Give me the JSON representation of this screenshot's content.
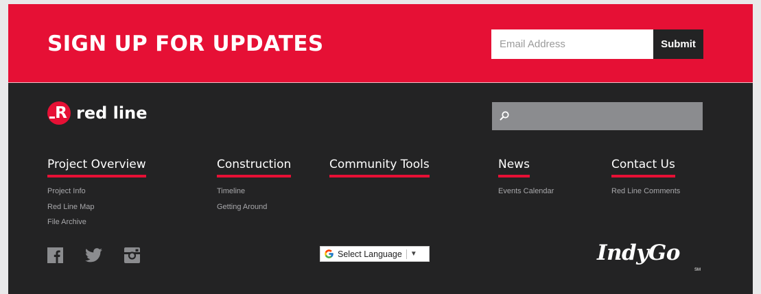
{
  "signup": {
    "title": "SIGN UP FOR UPDATES",
    "email_placeholder": "Email Address",
    "submit_label": "Submit"
  },
  "brand": {
    "logo_letter": "R",
    "logo_text": "red line",
    "accent_color": "#e61035",
    "background_color": "#232324"
  },
  "search": {
    "icon": "search-icon",
    "value": ""
  },
  "nav": {
    "columns": [
      {
        "heading": "Project Overview",
        "links": [
          "Project Info",
          "Red Line Map",
          "File Archive"
        ]
      },
      {
        "heading": "Construction",
        "links": [
          "Timeline",
          "Getting Around"
        ]
      },
      {
        "heading": "Community Tools",
        "links": []
      },
      {
        "heading": "News",
        "links": [
          "Events Calendar"
        ]
      },
      {
        "heading": "Contact Us",
        "links": [
          "Red Line Comments"
        ]
      }
    ]
  },
  "social": {
    "icons": [
      "facebook-icon",
      "twitter-icon",
      "instagram-icon"
    ]
  },
  "translate": {
    "label": "Select Language",
    "arrow": "▼",
    "icon": "google-g-icon"
  },
  "partner": {
    "name": "IndyGo",
    "mark": "SM"
  }
}
